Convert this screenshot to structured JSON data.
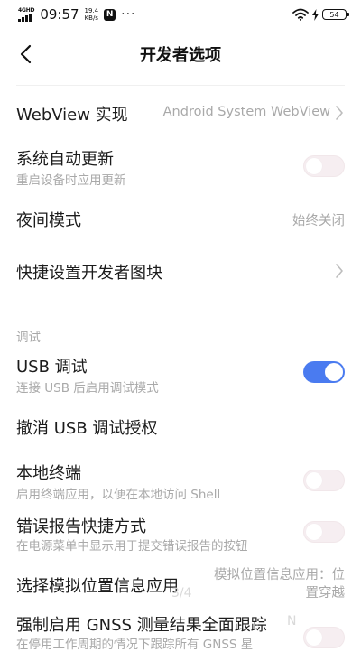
{
  "status_bar": {
    "network": "4GHD",
    "time": "09:57",
    "speed_value": "19.4",
    "speed_unit": "KB/s",
    "nfc": "N",
    "more": "···",
    "battery": "54"
  },
  "title_bar": {
    "title": "开发者选项"
  },
  "settings": {
    "webview": {
      "title": "WebView 实现",
      "value": "Android System WebView"
    },
    "auto_update": {
      "title": "系统自动更新",
      "subtitle": "重启设备时应用更新",
      "enabled": false
    },
    "night_mode": {
      "title": "夜间模式",
      "value": "始终关闭"
    },
    "quick_tiles": {
      "title": "快捷设置开发者图块"
    },
    "debug_section": {
      "label": "调试"
    },
    "usb_debug": {
      "title": "USB 调试",
      "subtitle": "连接 USB 后启用调试模式",
      "enabled": true
    },
    "revoke_usb": {
      "title": "撤消 USB 调试授权"
    },
    "local_terminal": {
      "title": "本地终端",
      "subtitle": "启用终端应用，以便在本地访问 Shell",
      "enabled": false
    },
    "bug_report": {
      "title": "错误报告快捷方式",
      "subtitle": "在电源菜单中显示用于提交错误报告的按钮",
      "enabled": false
    },
    "mock_location": {
      "title": "选择模拟位置信息应用",
      "value_line1": "模拟位置信息应用：位",
      "value_line2": "置穿越",
      "ghost_left": "3/4",
      "ghost_right": "N"
    },
    "gnss": {
      "title": "强制启用 GNSS 测量结果全面跟踪",
      "subtitle": "在停用工作周期的情况下跟踪所有 GNSS 星"
    }
  },
  "colors": {
    "accent": "#4a7bf0",
    "secondary_text": "#a9a9a9",
    "toggle_off": "#f6eef1"
  }
}
